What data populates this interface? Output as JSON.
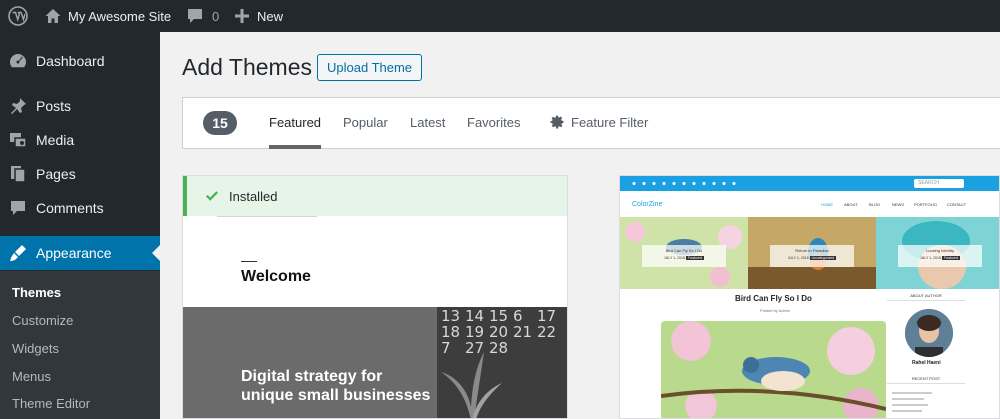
{
  "adminbar": {
    "site_name": "My Awesome Site",
    "comment_count": "0",
    "new_label": "New"
  },
  "sidebar": {
    "items": [
      {
        "label": "Dashboard",
        "icon": "dashboard-icon"
      },
      {
        "label": "Posts",
        "icon": "pin-icon"
      },
      {
        "label": "Media",
        "icon": "media-icon"
      },
      {
        "label": "Pages",
        "icon": "pages-icon"
      },
      {
        "label": "Comments",
        "icon": "comments-icon"
      },
      {
        "label": "Appearance",
        "icon": "brush-icon",
        "current": true
      }
    ],
    "submenu": [
      {
        "label": "Themes",
        "active": true
      },
      {
        "label": "Customize"
      },
      {
        "label": "Widgets"
      },
      {
        "label": "Menus"
      },
      {
        "label": "Theme Editor"
      }
    ]
  },
  "page": {
    "title": "Add Themes",
    "upload_button": "Upload Theme"
  },
  "filter_bar": {
    "count": "15",
    "tabs": [
      "Featured",
      "Popular",
      "Latest",
      "Favorites"
    ],
    "active_tab": "Featured",
    "feature_filter": "Feature Filter"
  },
  "themes": [
    {
      "installed_label": "Installed",
      "preview": {
        "heading": "Welcome",
        "hero_line1": "Digital strategy for",
        "hero_line2": "unique small businesses",
        "calendar_numbers": [
          "13",
          "14",
          "15",
          "6",
          "17",
          "18",
          "19",
          "20",
          "21",
          "22",
          "7",
          "27",
          "28"
        ]
      }
    },
    {
      "preview": {
        "search_text": "SEARCH",
        "logo": "ColorZine",
        "nav": [
          "HOME",
          "ABOUT",
          "BLOG",
          "NEWS",
          "PORTFOLIO",
          "CONTACT"
        ],
        "slides": [
          {
            "title": "Bird Can Fly So I Do",
            "date": "JULY 1, 2018",
            "tag": "Featured"
          },
          {
            "title": "Return to Paradise",
            "date": "JULY 1, 2018",
            "tag": "Uncategorized"
          },
          {
            "title": "Loosing Identity",
            "date": "JULY 1, 2018",
            "tag": "Featured"
          }
        ],
        "post_title": "Bird Can Fly So I Do",
        "post_meta": "Posted by Admin",
        "sidebar_heading": "ABOUT AUTHOR",
        "author": "Rahel Haeni",
        "recent_heading": "RECENT POST"
      }
    }
  ],
  "colors": {
    "admin_bg": "#23282d",
    "accent": "#0073aa",
    "installed_green": "#46b450"
  }
}
